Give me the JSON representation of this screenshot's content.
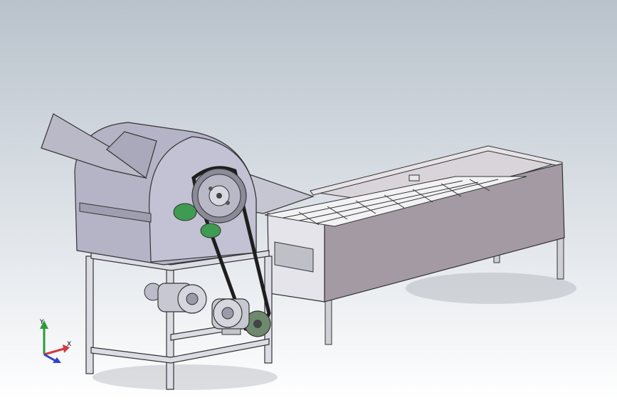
{
  "viewport": {
    "background_top": "#b9c2cb",
    "background_bottom": "#ffffff"
  },
  "model": {
    "body_color": "#b4b4c6",
    "pulley_color": "#8a8a99",
    "belt_color": "#1e1e1e",
    "motor_color": "#c8c8d2",
    "bearing_color": "#3f9a52",
    "tank_color": "#a39aa3"
  },
  "triad": {
    "y_label": "Y",
    "x_label": "X",
    "y_color": "#2f9a3a",
    "x_color": "#d23a3a",
    "z_color": "#2f45c8"
  }
}
